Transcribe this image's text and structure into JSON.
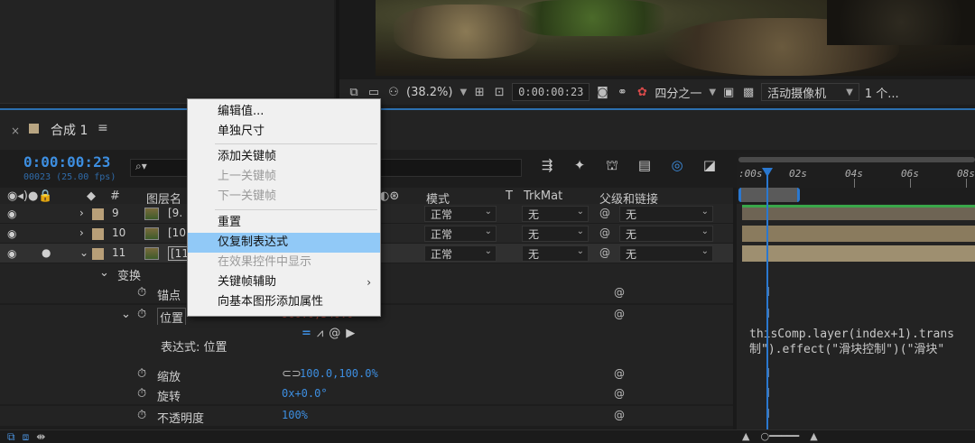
{
  "viewer_toolbar": {
    "zoom": "(38.2%)",
    "timecode": "0:00:00:23",
    "resolution": "四分之一",
    "camera": "活动摄像机",
    "views": "1 个..."
  },
  "comp": {
    "tab_close": "×",
    "tab_title": "合成 1",
    "tab_menu": "≡",
    "current_time": "0:00:00:23",
    "frame_fps": "00023 (25.00 fps)",
    "search_icon": "⌕▾"
  },
  "columns": {
    "num": "#",
    "name": "图层名",
    "mode": "模式",
    "t": "T",
    "trkmat": "TrkMat",
    "parent": "父级和链接"
  },
  "ruler": {
    "labels": [
      ":00s",
      "02s",
      "04s",
      "06s",
      "08s"
    ]
  },
  "layers": [
    {
      "num": "9",
      "name": "[9.",
      "mode": "正常",
      "trkmat": "无",
      "parent": "无"
    },
    {
      "num": "10",
      "name": "[10.",
      "mode": "正常",
      "trkmat": "无",
      "parent": "无"
    },
    {
      "num": "11",
      "name": "[11.",
      "mode": "正常",
      "trkmat": "无",
      "parent": "无"
    }
  ],
  "properties": {
    "transform": "变换",
    "anchor": "锚点",
    "position": "位置",
    "position_value": "960.0,540.0",
    "expression_label": "表达式: 位置",
    "scale": "缩放",
    "scale_value": "100.0,100.0%",
    "rotation": "旋转",
    "rotation_value": "0x+0.0°",
    "opacity": "不透明度",
    "opacity_value": "100%"
  },
  "expression_code": {
    "line1": "thisComp.layer(index+1).trans",
    "line2": "制\").effect(\"滑块控制\")(\"滑块\""
  },
  "context_menu": {
    "items": [
      {
        "label": "编辑值...",
        "disabled": false
      },
      {
        "label": "单独尺寸",
        "disabled": false
      },
      {
        "label": "添加关键帧",
        "disabled": false
      },
      {
        "label": "上一关键帧",
        "disabled": true
      },
      {
        "label": "下一关键帧",
        "disabled": true
      },
      {
        "label": "重置",
        "disabled": false
      },
      {
        "label": "仅复制表达式",
        "disabled": false,
        "highlighted": true
      },
      {
        "label": "在效果控件中显示",
        "disabled": true
      },
      {
        "label": "关键帧辅助",
        "disabled": false,
        "submenu": true
      },
      {
        "label": "向基本图形添加属性",
        "disabled": false
      }
    ]
  },
  "colors": {
    "accent_blue": "#3d8ee0",
    "menu_highlight": "#91c9f7",
    "layer_bar": "#8a7b5e",
    "label_swatch": "#b89f78"
  }
}
